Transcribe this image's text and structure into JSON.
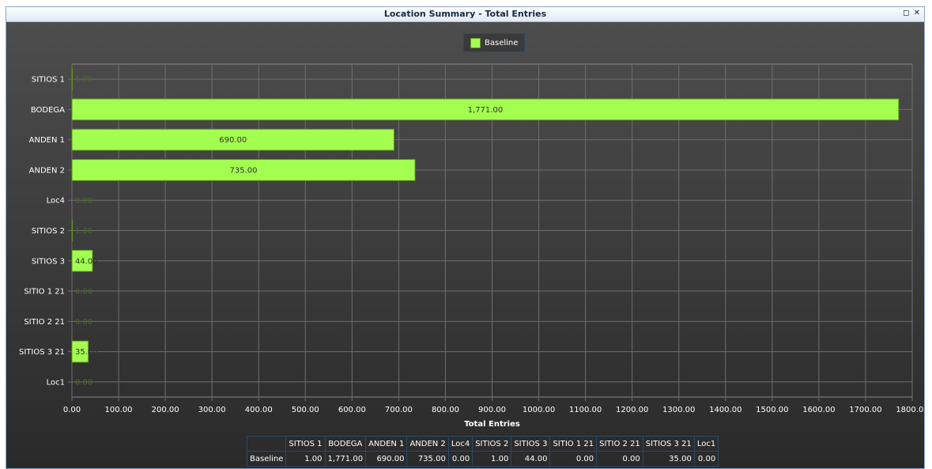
{
  "window": {
    "title": "Location Summary - Total Entries",
    "restore_icon": "restore-icon",
    "close_icon": "close-icon",
    "restore_glyph": "◻",
    "close_glyph": "✕"
  },
  "legend": {
    "label": "Baseline",
    "color": "#a3ff4f"
  },
  "chart_data": {
    "type": "bar",
    "orientation": "horizontal",
    "categories": [
      "SITIOS 1",
      "BODEGA",
      "ANDEN 1",
      "ANDEN 2",
      "Loc4",
      "SITIOS 2",
      "SITIOS 3",
      "SITIO 1 21",
      "SITIO 2 21",
      "SITIOS 3 21",
      "Loc1"
    ],
    "series": [
      {
        "name": "Baseline",
        "values": [
          1.0,
          1771.0,
          690.0,
          735.0,
          0.0,
          1.0,
          44.0,
          0.0,
          0.0,
          35.0,
          0.0
        ],
        "color": "#a3ff4f"
      }
    ],
    "data_labels": [
      "1.00",
      "1,771.00",
      "690.00",
      "735.00",
      "0.00",
      "1.00",
      "44.00",
      "0.00",
      "0.00",
      "35.00",
      "0.00"
    ],
    "x_ticks": [
      "0.00",
      "100.00",
      "200.00",
      "300.00",
      "400.00",
      "500.00",
      "600.00",
      "700.00",
      "800.00",
      "900.00",
      "1000.00",
      "1100.00",
      "1200.00",
      "1300.00",
      "1400.00",
      "1500.00",
      "1600.00",
      "1700.00",
      "1800.00"
    ],
    "xlim": [
      0,
      1800
    ],
    "xlabel": "Total Entries",
    "ylabel": "",
    "grid": true,
    "legend_position": "top-center"
  },
  "table": {
    "columns": [
      "SITIOS 1",
      "BODEGA",
      "ANDEN 1",
      "ANDEN 2",
      "Loc4",
      "SITIOS 2",
      "SITIOS 3",
      "SITIO 1 21",
      "SITIO 2 21",
      "SITIOS 3 21",
      "Loc1"
    ],
    "rows": [
      {
        "label": "Baseline",
        "values": [
          "1.00",
          "1,771.00",
          "690.00",
          "735.00",
          "0.00",
          "1.00",
          "44.00",
          "0.00",
          "0.00",
          "35.00",
          "0.00"
        ]
      }
    ]
  }
}
